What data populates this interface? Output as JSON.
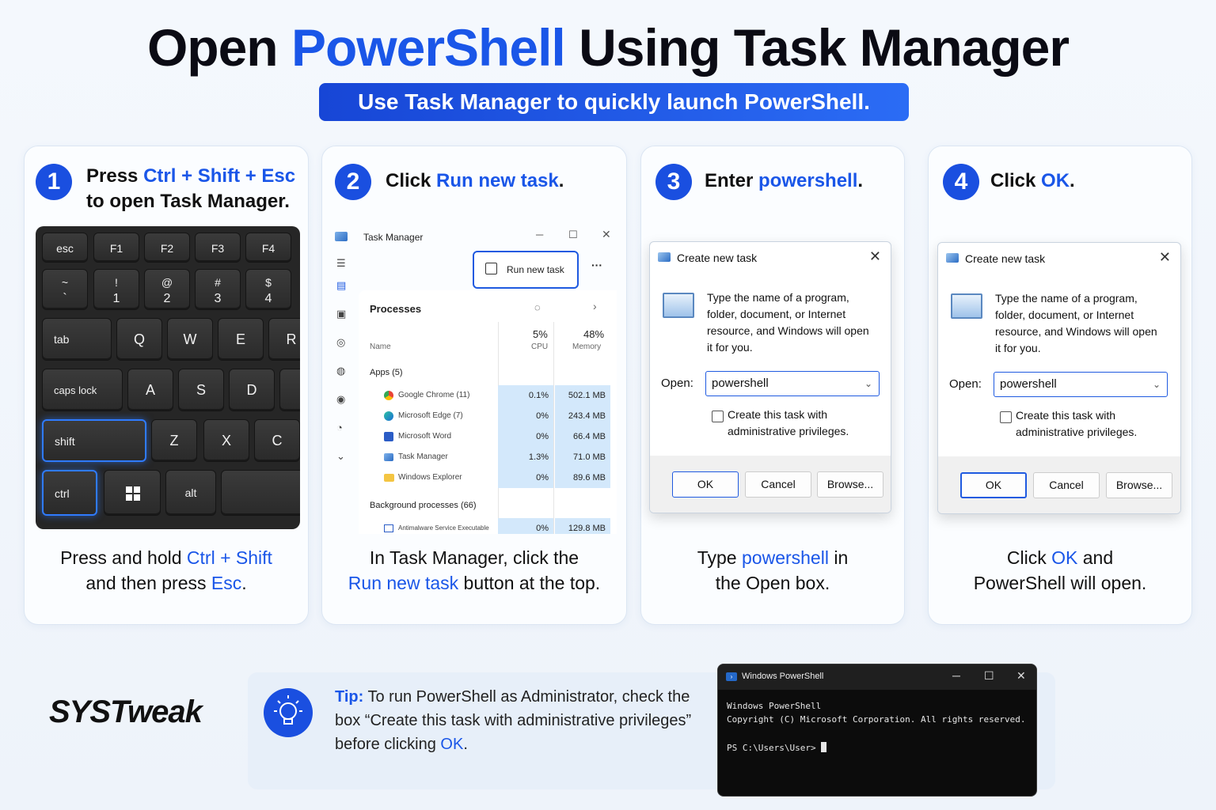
{
  "header": {
    "title_pre": "Open ",
    "title_accent": "PowerShell",
    "title_post": " Using Task Manager",
    "subtitle": "Use Task Manager to quickly launch PowerShell."
  },
  "colors": {
    "accent": "#1a56e8",
    "step_circle": "#1a4fe0",
    "keyboard_bg": "#262626",
    "highlight": "#2f7bff"
  },
  "steps": [
    {
      "number": "1",
      "head_pre": "Press ",
      "head_accent": "Ctrl + Shift + Esc",
      "head_line2": "to open Task Manager.",
      "caption_pre": "Press and hold ",
      "caption_accent1": "Ctrl + Shift",
      "caption_mid": "and then press ",
      "caption_accent2": "Esc",
      "caption_end": "."
    },
    {
      "number": "2",
      "head_pre": "Click ",
      "head_accent": "Run new task",
      "head_end": ".",
      "caption_line1": "In Task Manager, click the",
      "caption_accent": "Run new task",
      "caption_end": " button at the top."
    },
    {
      "number": "3",
      "head_pre": "Enter ",
      "head_accent": "powershell",
      "head_end": ".",
      "caption_pre": "Type ",
      "caption_accent": "powershell",
      "caption_mid": " in",
      "caption_line2": "the Open box."
    },
    {
      "number": "4",
      "head_pre": "Click ",
      "head_accent": "OK",
      "head_end": ".",
      "caption_pre": "Click ",
      "caption_accent": "OK",
      "caption_mid": " and",
      "caption_line2": "PowerShell will open."
    }
  ],
  "keyboard": {
    "row1": [
      "esc",
      "F1",
      "F2",
      "F3",
      "F4"
    ],
    "row2": [
      [
        "~",
        "`"
      ],
      [
        "!",
        "1"
      ],
      [
        "@",
        "2"
      ],
      [
        "#",
        "3"
      ],
      [
        "$",
        "4"
      ]
    ],
    "row3": [
      "tab",
      "Q",
      "W",
      "E",
      "R"
    ],
    "row4": [
      "caps lock",
      "A",
      "S",
      "D"
    ],
    "row5": [
      "shift",
      "Z",
      "X",
      "C"
    ],
    "row6": [
      "ctrl",
      "alt"
    ]
  },
  "task_manager": {
    "title": "Task Manager",
    "run_new_task": "Run new task",
    "more": "···",
    "processes": "Processes",
    "cpu_pct": "5%",
    "cpu_label": "CPU",
    "mem_pct": "48%",
    "mem_label": "Memory",
    "name_col": "Name",
    "apps_header": "Apps (5)",
    "apps": [
      {
        "name": "Google Chrome (11)",
        "cpu": "0.1%",
        "mem": "502.1 MB"
      },
      {
        "name": "Microsoft Edge (7)",
        "cpu": "0%",
        "mem": "243.4 MB"
      },
      {
        "name": "Microsoft Word",
        "cpu": "0%",
        "mem": "66.4 MB"
      },
      {
        "name": "Task Manager",
        "cpu": "1.3%",
        "mem": "71.0 MB"
      },
      {
        "name": "Windows Explorer",
        "cpu": "0%",
        "mem": "89.6 MB"
      }
    ],
    "bg_header": "Background processes (66)",
    "bg_row": {
      "name": "Antimalware Service Executable",
      "cpu": "0%",
      "mem": "129.8 MB"
    }
  },
  "dialog": {
    "title": "Create new task",
    "message": "Type the name of a program, folder, document, or Internet resource, and Windows will open it for you.",
    "open_label": "Open:",
    "open_value": "powershell",
    "checkbox_label": "Create this task with administrative privileges.",
    "ok": "OK",
    "cancel": "Cancel",
    "browse": "Browse..."
  },
  "logo": "SYSTweak",
  "tip": {
    "label": "Tip:",
    "text": " To run PowerShell as Administrator, check the box “Create this task with administrative privileges” before clicking ",
    "accent": "OK",
    "end": "."
  },
  "powershell": {
    "title": "Windows PowerShell",
    "line1": "Windows PowerShell",
    "line2": "Copyright (C) Microsoft Corporation. All rights reserved.",
    "prompt": "PS C:\\Users\\User> "
  }
}
